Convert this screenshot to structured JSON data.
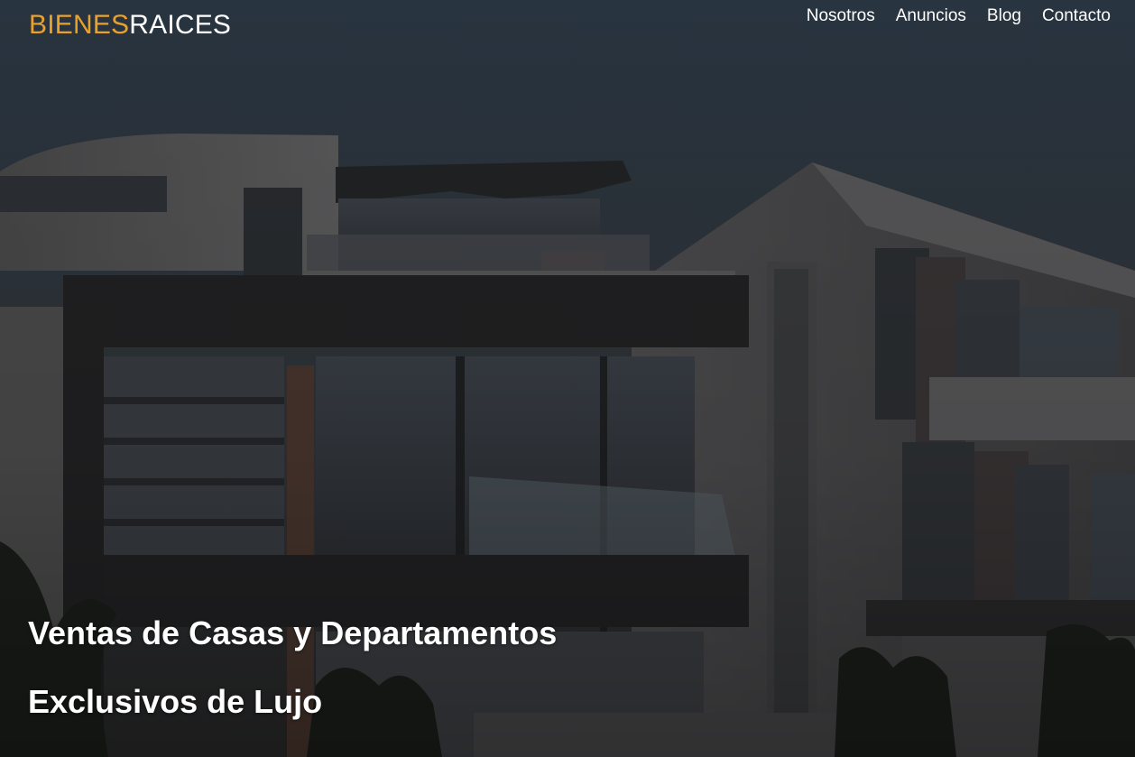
{
  "logo": {
    "part1": "BIENES",
    "part2": "RAICES"
  },
  "nav": {
    "items": [
      {
        "label": "Nosotros"
      },
      {
        "label": "Anuncios"
      },
      {
        "label": "Blog"
      },
      {
        "label": "Contacto"
      }
    ]
  },
  "hero": {
    "line1": "Ventas de Casas y Departamentos",
    "line2": "Exclusivos de Lujo"
  },
  "colors": {
    "accent": "#e8a12c",
    "text": "#ffffff"
  }
}
